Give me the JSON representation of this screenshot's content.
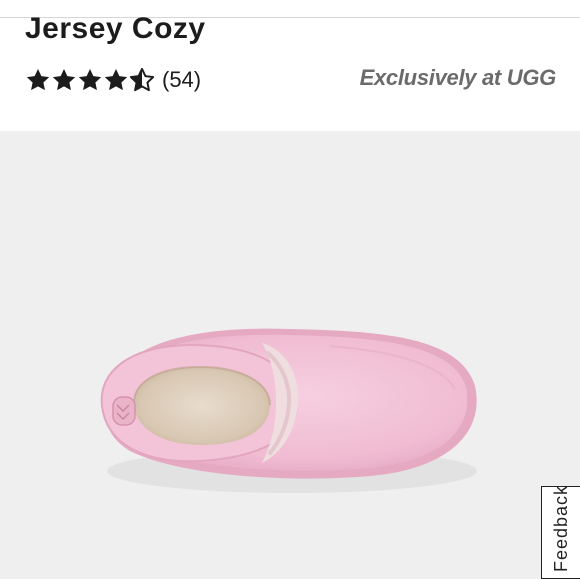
{
  "product": {
    "title": "Jersey Cozy",
    "rating": {
      "value": 4.5,
      "max": 5,
      "count_label": "(54)"
    },
    "exclusive_label": "Exclusively at UGG"
  },
  "image": {
    "alt": "Pink Jersey Cozy boot, top view",
    "background_color": "#efefef",
    "boot_color": "#f2bfd4"
  },
  "feedback_tab": {
    "label": "Feedback"
  }
}
